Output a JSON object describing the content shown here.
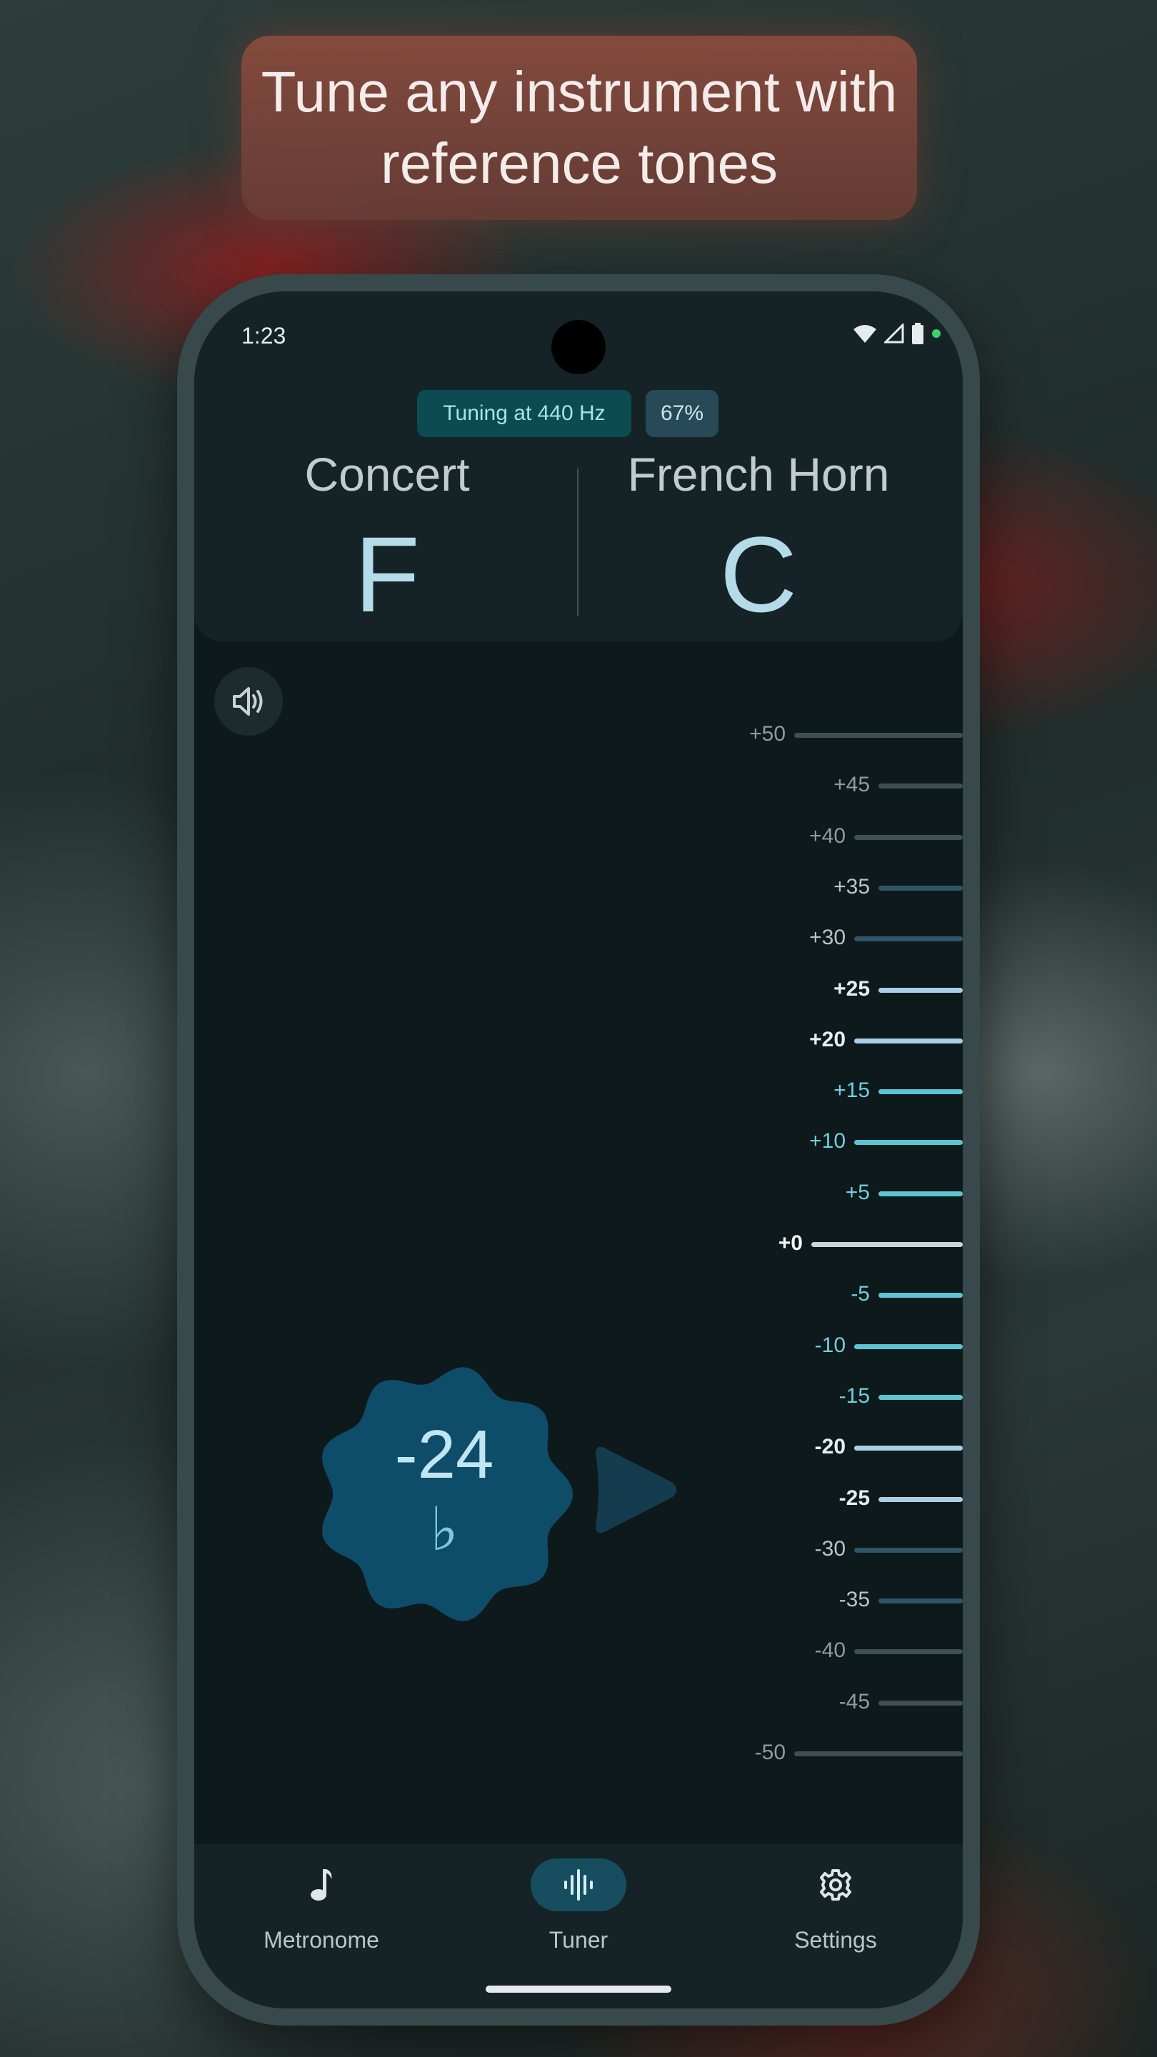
{
  "banner": {
    "text": "Tune any instrument with reference tones"
  },
  "status_bar": {
    "time": "1:23",
    "icons": [
      "wifi-icon",
      "cell-signal-icon",
      "battery-icon"
    ]
  },
  "header": {
    "reference_chip": "Tuning at 440 Hz",
    "volume_chip": "67%",
    "concert": {
      "label": "Concert",
      "note": "F"
    },
    "instrument": {
      "label": "French Horn",
      "note": "C"
    }
  },
  "tuner": {
    "cents_offset": "-24",
    "accidental": "♭",
    "speaker_icon": "speaker-icon",
    "scale": [
      "+50",
      "+45",
      "+40",
      "+35",
      "+30",
      "+25",
      "+20",
      "+15",
      "+10",
      "+5",
      "+0",
      "-5",
      "-10",
      "-15",
      "-20",
      "-25",
      "-30",
      "-35",
      "-40",
      "-45",
      "-50"
    ]
  },
  "nav": {
    "items": [
      {
        "label": "Metronome",
        "icon": "music-note-icon"
      },
      {
        "label": "Tuner",
        "icon": "waveform-icon"
      },
      {
        "label": "Settings",
        "icon": "gear-icon"
      }
    ],
    "active": "Tuner"
  },
  "colors": {
    "accent": "#5cc4d4",
    "highlight": "#a9cfe8",
    "needle": "#0e4d6a"
  }
}
